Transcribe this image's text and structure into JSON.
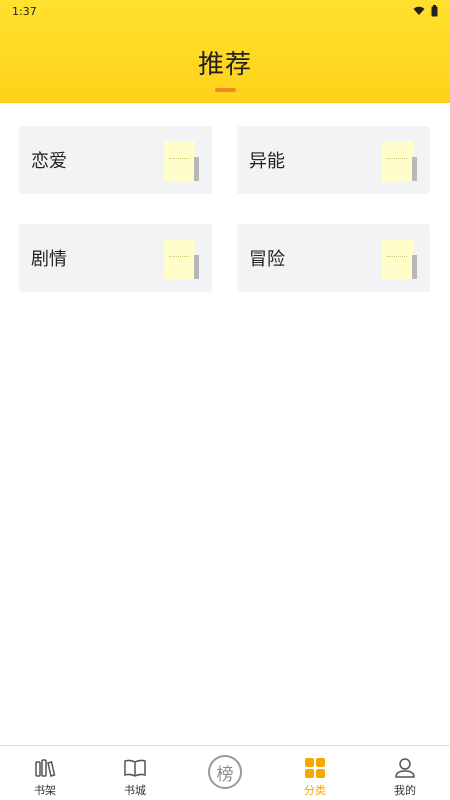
{
  "status": {
    "time": "1:37"
  },
  "header": {
    "title": "推荐"
  },
  "categories": [
    {
      "label": "恋爱"
    },
    {
      "label": "异能"
    },
    {
      "label": "剧情"
    },
    {
      "label": "冒险"
    }
  ],
  "tabbar": {
    "items": [
      {
        "label": "书架",
        "icon": "bookshelf-icon"
      },
      {
        "label": "书城",
        "icon": "open-book-icon"
      },
      {
        "label": "",
        "icon": "rank-badge-icon",
        "badge_text": "榜"
      },
      {
        "label": "分类",
        "icon": "category-grid-icon",
        "active": true
      },
      {
        "label": "我的",
        "icon": "user-icon"
      }
    ]
  },
  "colors": {
    "header_yellow": "#ffd11a",
    "accent_orange": "#f08a1c",
    "active_tab": "#f6a800",
    "card_bg": "#f2f3f4"
  }
}
